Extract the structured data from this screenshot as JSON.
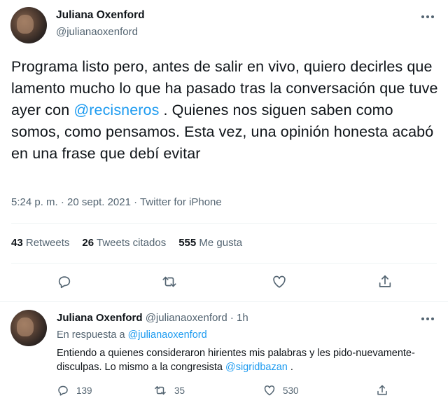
{
  "main_tweet": {
    "author_name": "Juliana Oxenford",
    "author_handle": "@julianaoxenford",
    "text_part1": "Programa listo pero, antes de salir en vivo, quiero decirles que lamento mucho lo que ha pasado tras la conversación que tuve ayer con ",
    "mention": "@recisneros",
    "text_part2": " . Quienes nos siguen saben como somos, como pensamos. Esta vez, una opinión honesta acabó en una frase que debí evitar",
    "timestamp": "5:24 p. m. · 20 sept. 2021 · Twitter for iPhone",
    "stats": {
      "retweets_count": "43",
      "retweets_label": "Retweets",
      "quotes_count": "26",
      "quotes_label": "Tweets citados",
      "likes_count": "555",
      "likes_label": "Me gusta"
    },
    "actions": [
      "reply-icon",
      "retweet-icon",
      "like-icon",
      "share-icon"
    ]
  },
  "reply_tweet": {
    "author_name": "Juliana Oxenford",
    "author_handle": "@julianaoxenford",
    "time": "· 1h",
    "replying_prefix": "En respuesta a ",
    "replying_to": "@julianaoxenford",
    "text_part1": "Entiendo a quienes consideraron hirientes mis palabras y les pido-nuevamente- disculpas. Lo mismo a la congresista ",
    "mention": "@sigridbazan",
    "text_part2": " .",
    "replies_count": "139",
    "retweets_count": "35",
    "likes_count": "530"
  },
  "colors": {
    "text": "#0f1419",
    "secondary": "#536471",
    "link": "#1d9bf0",
    "divider": "#eff3f4"
  }
}
